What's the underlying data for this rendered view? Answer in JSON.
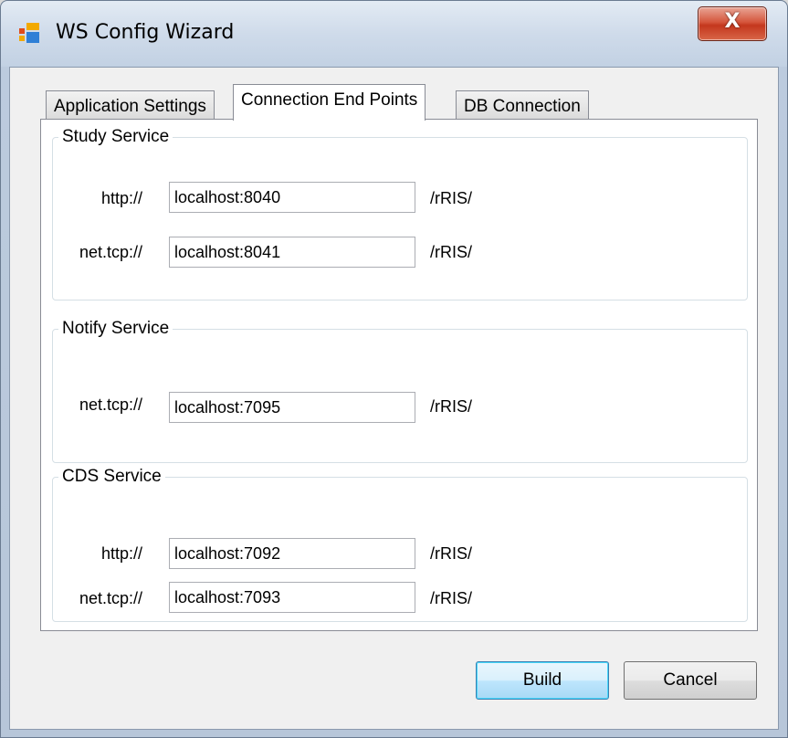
{
  "window": {
    "title": "WS Config Wizard",
    "close_glyph": "X"
  },
  "tabs": [
    {
      "label": "Application Settings",
      "active": false
    },
    {
      "label": "Connection End Points",
      "active": true
    },
    {
      "label": "DB Connection",
      "active": false
    }
  ],
  "groups": {
    "study": {
      "title": "Study Service",
      "rows": [
        {
          "label": "http://",
          "value": "localhost:8040",
          "suffix": "/rRIS/"
        },
        {
          "label": "net.tcp://",
          "value": "localhost:8041",
          "suffix": "/rRIS/"
        }
      ]
    },
    "notify": {
      "title": "Notify Service",
      "rows": [
        {
          "label": "net.tcp://",
          "value": "localhost:7095",
          "suffix": "/rRIS/"
        }
      ]
    },
    "cds": {
      "title": "CDS Service",
      "rows": [
        {
          "label": "http://",
          "value": "localhost:7092",
          "suffix": "/rRIS/"
        },
        {
          "label": "net.tcp://",
          "value": "localhost:7093",
          "suffix": "/rRIS/"
        }
      ]
    }
  },
  "buttons": {
    "build": "Build",
    "cancel": "Cancel"
  },
  "icons": {
    "app": "windows-form-icon",
    "close": "close-icon"
  },
  "colors": {
    "close_button": "#c4371d",
    "default_button_border": "#3c7fb1"
  }
}
